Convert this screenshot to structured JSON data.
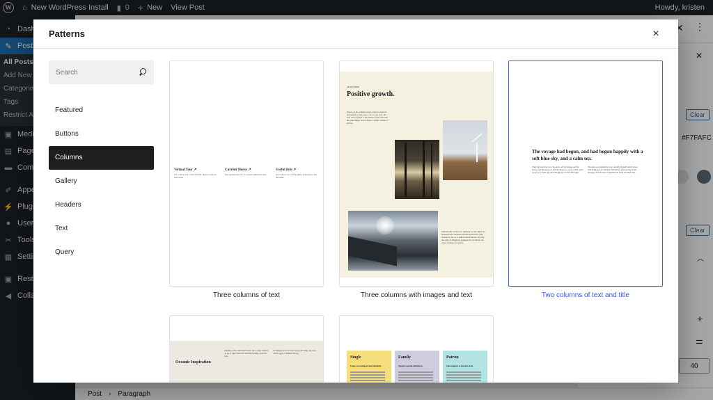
{
  "admin_bar": {
    "site_name": "New WordPress Install",
    "comments_count": "0",
    "new_label": "New",
    "view_post_label": "View Post",
    "howdy": "Howdy, kristen"
  },
  "admin_menu": {
    "dashboard": "Dashb",
    "posts": "Posts",
    "sub": [
      "All Posts",
      "Add New",
      "Categories",
      "Tags",
      "Restrict Ac"
    ],
    "media": "Media",
    "pages": "Pages",
    "comments": "Comm",
    "appearance": "Appea",
    "plugins": "Plugin",
    "users": "Users",
    "tools": "Tools",
    "settings": "Settin",
    "restrict": "Restri",
    "collapse": "Collap"
  },
  "editor_sidebar": {
    "clear_label": "Clear",
    "hex_value": "#F7FAFC",
    "number_value": "40",
    "swatch_colors": [
      "#ffffff",
      "#e2e4e7",
      "#5e6a7a"
    ]
  },
  "breadcrumb": {
    "post": "Post",
    "separator": "›",
    "paragraph": "Paragraph"
  },
  "modal": {
    "title": "Patterns",
    "close_icon": "×",
    "search_placeholder": "Search",
    "categories": [
      "Featured",
      "Buttons",
      "Columns",
      "Gallery",
      "Headers",
      "Text",
      "Query"
    ],
    "active_category": "Columns"
  },
  "patterns": [
    {
      "caption": "Three columns of text",
      "columns": [
        {
          "heading": "Virtual Tour ↗",
          "text": "Get a virtual tour of the museum. Ideal for schools and events."
        },
        {
          "heading": "Current Shows ↗",
          "text": "Stay updated and see our current exhibitions here."
        },
        {
          "heading": "Useful Info ↗",
          "text": "Get to know our opening times, ticket prices and discounts."
        }
      ]
    },
    {
      "caption": "Three columns with images and text",
      "eyebrow": "ECOSYSTEM",
      "heading": "Positive growth.",
      "body_1": "Nature, in the common sense, refers to essences unchanged by man; space, the air, the river, the leaf. Art is applied to the mixture of his will with the same things, as in a house, a canal, a statue, a picture.",
      "body_2": "Undoubtedly we have no questions to ask which are unanswerable. We must trust the perfection of the creation so far, as to believe that whatever curiosity the order of things has awakened in our minds, the order of things can satisfy."
    },
    {
      "caption": "Two columns of text and title",
      "heading": "The voyage had begun, and had begun happily with a soft blue sky, and a calm sea.",
      "col_1": "They followed her on to the deck. All the smoke and the houses had disappeared, and the ship was out in a wide space of sea very fresh and clear though pale in the early light.",
      "col_2": "The ship was making her way steadily through small waves which slapped her and then fizzled like effervescing water, leaving a little border of bubbles and foam on either side."
    },
    {
      "caption": "",
      "heading": "Oceanic Inspiration",
      "col_1": "Winding veils round their heads, the women walked on deck. They were now moving steadily down the river.",
      "col_2": "As industry has increased along the banks, the river carries signs of human activity."
    },
    {
      "caption": "",
      "tiers": [
        {
          "name": "Single",
          "subtitle": "Enjoy an evening of entertainment.",
          "color": "#f6de7b"
        },
        {
          "name": "Family",
          "subtitle": "Support special exhibitions.",
          "color": "#cfcce0"
        },
        {
          "name": "Patron",
          "subtitle": "Take support to the next level.",
          "color": "#b3e2e2"
        }
      ]
    }
  ]
}
